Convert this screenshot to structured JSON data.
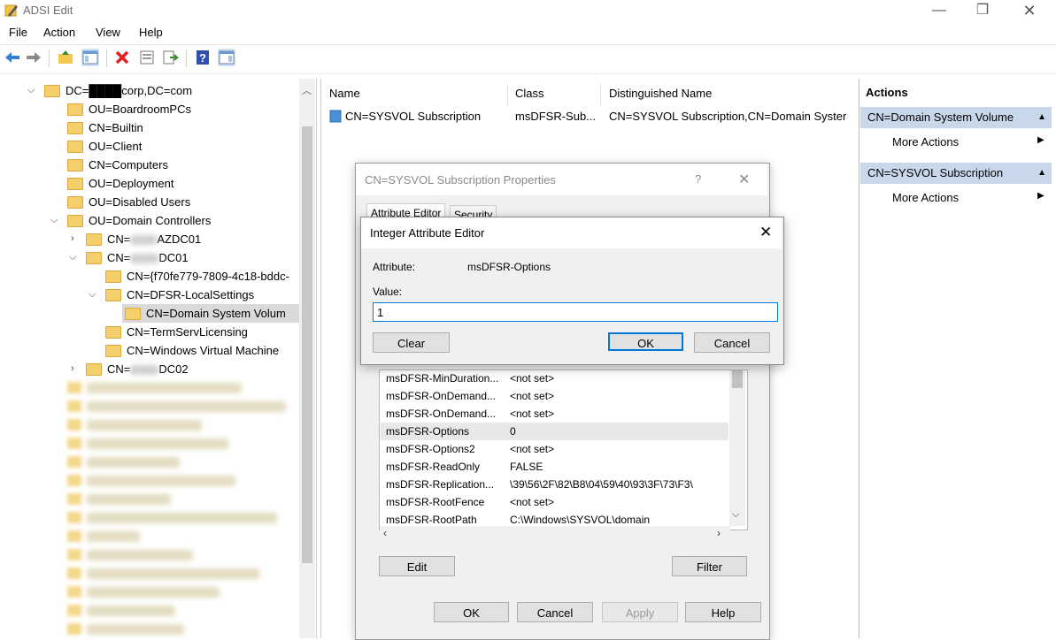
{
  "window": {
    "title": "ADSI Edit"
  },
  "menu": [
    "File",
    "Action",
    "View",
    "Help"
  ],
  "tree": {
    "root": "DC=████corp,DC=com",
    "items": [
      {
        "label": "OU=BoardroomPCs"
      },
      {
        "label": "CN=Builtin"
      },
      {
        "label": "OU=Client"
      },
      {
        "label": "CN=Computers"
      },
      {
        "label": "OU=Deployment"
      },
      {
        "label": "OU=Disabled Users"
      },
      {
        "label": "OU=Domain Controllers"
      },
      {
        "label_prefix": "CN=",
        "label_suffix": "AZDC01"
      },
      {
        "label_prefix": "CN=",
        "label_suffix": "DC01"
      },
      {
        "label": "CN={f70fe779-7809-4c18-bddc-"
      },
      {
        "label": "CN=DFSR-LocalSettings"
      },
      {
        "label": "CN=Domain System Volum"
      },
      {
        "label": "CN=TermServLicensing"
      },
      {
        "label": "CN=Windows Virtual Machine"
      },
      {
        "label_prefix": "CN=",
        "label_suffix": "DC02"
      }
    ]
  },
  "list": {
    "columns": [
      "Name",
      "Class",
      "Distinguished Name"
    ],
    "rows": [
      {
        "name": "CN=SYSVOL Subscription",
        "class": "msDFSR-Sub...",
        "dn": "CN=SYSVOL Subscription,CN=Domain Syster"
      }
    ]
  },
  "actions": {
    "title": "Actions",
    "sections": [
      {
        "header": "CN=Domain System Volume",
        "item": "More Actions"
      },
      {
        "header": "CN=SYSVOL Subscription",
        "item": "More Actions"
      }
    ]
  },
  "prop_dialog": {
    "title": "CN=SYSVOL Subscription Properties",
    "help": "?",
    "tabs": [
      "Attribute Editor",
      "Security"
    ],
    "attributes": [
      {
        "name": "msDFSR-MinDuration...",
        "value": "<not set>"
      },
      {
        "name": "msDFSR-OnDemand...",
        "value": "<not set>"
      },
      {
        "name": "msDFSR-OnDemand...",
        "value": "<not set>"
      },
      {
        "name": "msDFSR-Options",
        "value": "0"
      },
      {
        "name": "msDFSR-Options2",
        "value": "<not set>"
      },
      {
        "name": "msDFSR-ReadOnly",
        "value": "FALSE"
      },
      {
        "name": "msDFSR-Replication...",
        "value": "\\39\\56\\2F\\82\\B8\\04\\59\\40\\93\\3F\\73\\F3\\"
      },
      {
        "name": "msDFSR-RootFence",
        "value": "<not set>"
      },
      {
        "name": "msDFSR-RootPath",
        "value": "C:\\Windows\\SYSVOL\\domain"
      }
    ],
    "edit": "Edit",
    "filter": "Filter",
    "ok": "OK",
    "cancel": "Cancel",
    "apply": "Apply",
    "help_btn": "Help"
  },
  "int_dialog": {
    "title": "Integer Attribute Editor",
    "attribute_label": "Attribute:",
    "attribute_value": "msDFSR-Options",
    "value_label": "Value:",
    "value": "1",
    "clear": "Clear",
    "ok": "OK",
    "cancel": "Cancel"
  },
  "colors": {
    "accent": "#0078d7",
    "action_header": "#c8d8ea",
    "folder": "#f5cf6b"
  }
}
